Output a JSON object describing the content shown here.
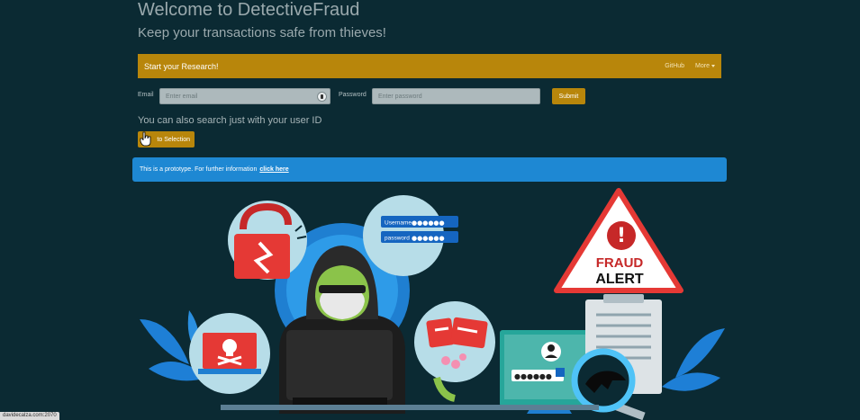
{
  "hero": {
    "title": "Welcome to DetectiveFraud",
    "subtitle": "Keep your transactions safe from thieves!"
  },
  "navbar": {
    "brand": "Start your Research!",
    "links": [
      "GitHub",
      "More"
    ]
  },
  "login": {
    "email_label": "Email",
    "email_placeholder": "Enter email",
    "password_label": "Password",
    "password_placeholder": "Enter password",
    "submit_label": "Submit"
  },
  "userid": {
    "text": "You can also search just with your user ID",
    "button_label": "to Selection"
  },
  "alert": {
    "text": "This is a prototype. For further information",
    "link_text": "click here"
  },
  "illustration": {
    "username_label": "Username",
    "password_label": "password",
    "password_dots": "●●●●●●",
    "fraud_word": "FRAUD",
    "alert_word": "ALERT",
    "sign_symbol": "!"
  },
  "status_bar": {
    "url": "davidecalza.com:2070"
  },
  "colors": {
    "background": "#0b2a33",
    "accent": "#b8860b",
    "info": "#1e88d3",
    "danger": "#e53935"
  }
}
